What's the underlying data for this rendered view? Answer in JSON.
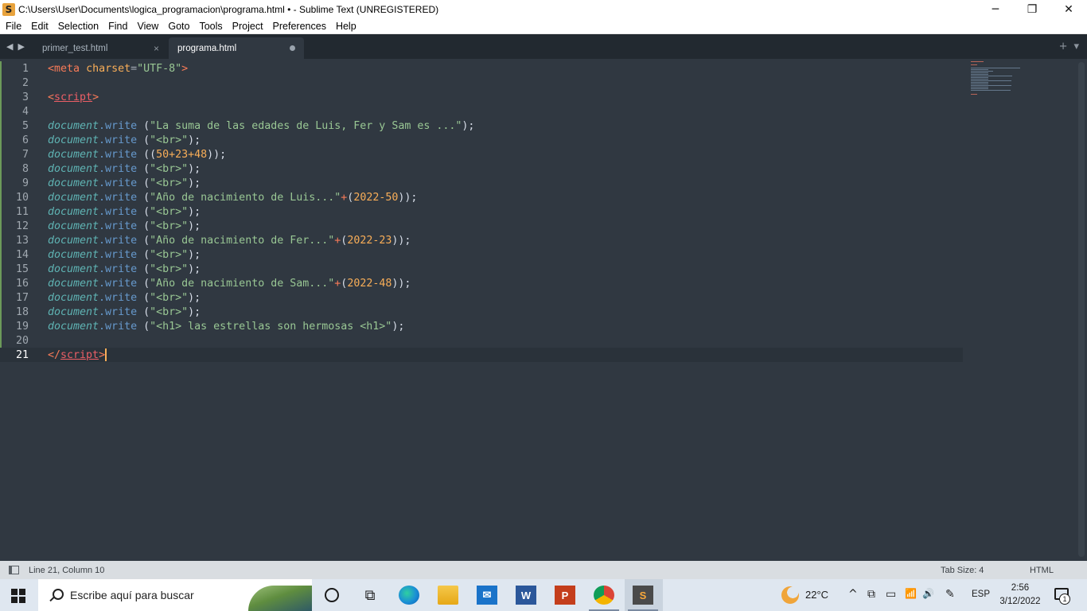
{
  "window": {
    "title": "C:\\Users\\User\\Documents\\logica_programacion\\programa.html • - Sublime Text (UNREGISTERED)",
    "app_icon_letter": "S",
    "controls": {
      "minimize": "─",
      "maximize": "❐",
      "close": "✕"
    }
  },
  "menu": [
    "File",
    "Edit",
    "Selection",
    "Find",
    "View",
    "Goto",
    "Tools",
    "Project",
    "Preferences",
    "Help"
  ],
  "tabs": [
    {
      "label": "primer_test.html",
      "active": false,
      "close": "×"
    },
    {
      "label": "programa.html",
      "active": true,
      "dirty": true
    }
  ],
  "tabbar_right": {
    "new_tab": "+",
    "dropdown": "▾"
  },
  "editor": {
    "current_line": 21,
    "line_numbers": [
      "1",
      "2",
      "3",
      "4",
      "5",
      "6",
      "7",
      "8",
      "9",
      "10",
      "11",
      "12",
      "13",
      "14",
      "15",
      "16",
      "17",
      "18",
      "19",
      "20",
      "21"
    ],
    "tokens": {
      "lt": "<",
      "gt": ">",
      "lt_slash": "</",
      "meta": "meta",
      "charset": "charset",
      "eq": "=",
      "utf8": "\"UTF-8\"",
      "script": "script",
      "document": "document",
      "dot_write": ".write",
      "sp_paren": " (",
      "semicolon": ");",
      "close_paren2": "));",
      "plus": "+",
      "open_paren": "(",
      "str_suma": "\"La suma de las edades de Luis, Fer y Sam es ...\"",
      "str_br": "\"<br>\"",
      "num_sum": "50+23+48",
      "str_luis": "\"Año de nacimiento de Luis...\"",
      "num_luis": "2022-50",
      "str_fer": "\"Año de nacimiento de Fer...\"",
      "num_fer": "2022-23",
      "str_sam": "\"Año de nacimiento de Sam...\"",
      "num_sam": "2022-48",
      "str_h1": "\"<h1> las estrellas son hermosas <h1>\""
    }
  },
  "status": {
    "position": "Line 21, Column 10",
    "tab_size": "Tab Size: 4",
    "syntax": "HTML"
  },
  "taskbar": {
    "search_placeholder": "Escribe aquí para buscar",
    "apps": [
      "cortana-icon",
      "task-view-icon",
      "edge-icon",
      "file-explorer-icon",
      "mail-icon",
      "word-icon",
      "powerpoint-icon",
      "chrome-icon",
      "sublime-text-icon"
    ],
    "word_letter": "W",
    "ppt_letter": "P",
    "sublime_letter": "S",
    "temperature": "22°C",
    "language": "ESP",
    "time": "2:56",
    "date": "3/12/2022",
    "notification_count": "1",
    "chevron": "^",
    "volume": "🔊",
    "network": "📶",
    "battery": "▭",
    "pen": "✎",
    "meet": "⧉"
  },
  "colors": {
    "editor_bg": "#303841",
    "tabbar_bg": "#222930",
    "tag": "#f97b58",
    "string": "#99c794",
    "number": "#f9ae58",
    "object": "#5fb4b4",
    "function": "#6699cc",
    "statusbar_bg": "#d9dde1",
    "taskbar_bg": "#dfe7f0"
  }
}
